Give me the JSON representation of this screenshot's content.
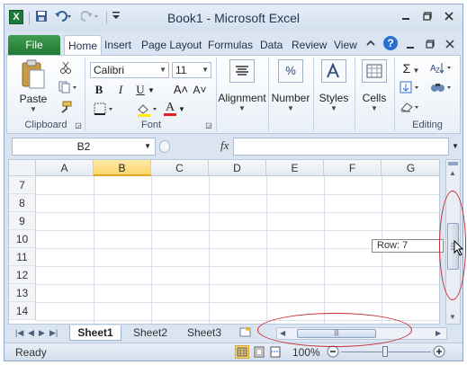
{
  "titlebar": {
    "app_icon": "X",
    "title": "Book1 - Microsoft Excel",
    "qat": [
      "save-icon",
      "undo-icon",
      "redo-icon",
      "customize-qat-icon"
    ]
  },
  "tabs": {
    "file": "File",
    "items": [
      "Home",
      "Insert",
      "Page Layout",
      "Formulas",
      "Data",
      "Review",
      "View"
    ],
    "active": "Home"
  },
  "ribbon": {
    "clipboard": {
      "paste": "Paste",
      "label": "Clipboard"
    },
    "font": {
      "name": "Calibri",
      "size": "11",
      "bold": "B",
      "italic": "I",
      "underline": "U",
      "grow": "A˄",
      "shrink": "A˅",
      "color": "A",
      "label": "Font"
    },
    "alignment": {
      "label": "Alignment"
    },
    "number": {
      "label": "Number",
      "icon": "%"
    },
    "styles": {
      "label": "Styles"
    },
    "cells": {
      "label": "Cells"
    },
    "editing": {
      "label": "Editing",
      "sum": "Σ"
    }
  },
  "formula_bar": {
    "name_box": "B2",
    "fx": "fx",
    "value": ""
  },
  "grid": {
    "columns": [
      "A",
      "B",
      "C",
      "D",
      "E",
      "F",
      "G"
    ],
    "selected_column": "B",
    "rows": [
      "7",
      "8",
      "9",
      "10",
      "11",
      "12",
      "13",
      "14"
    ]
  },
  "tooltip": "Row: 7",
  "sheets": {
    "tabs": [
      "Sheet1",
      "Sheet2",
      "Sheet3"
    ],
    "active": "Sheet1"
  },
  "status": {
    "mode": "Ready",
    "zoom": "100%"
  },
  "colors": {
    "annotation": "#c9282d",
    "file_tab": "#1f7a33",
    "selected_header": "#f9d76b"
  }
}
